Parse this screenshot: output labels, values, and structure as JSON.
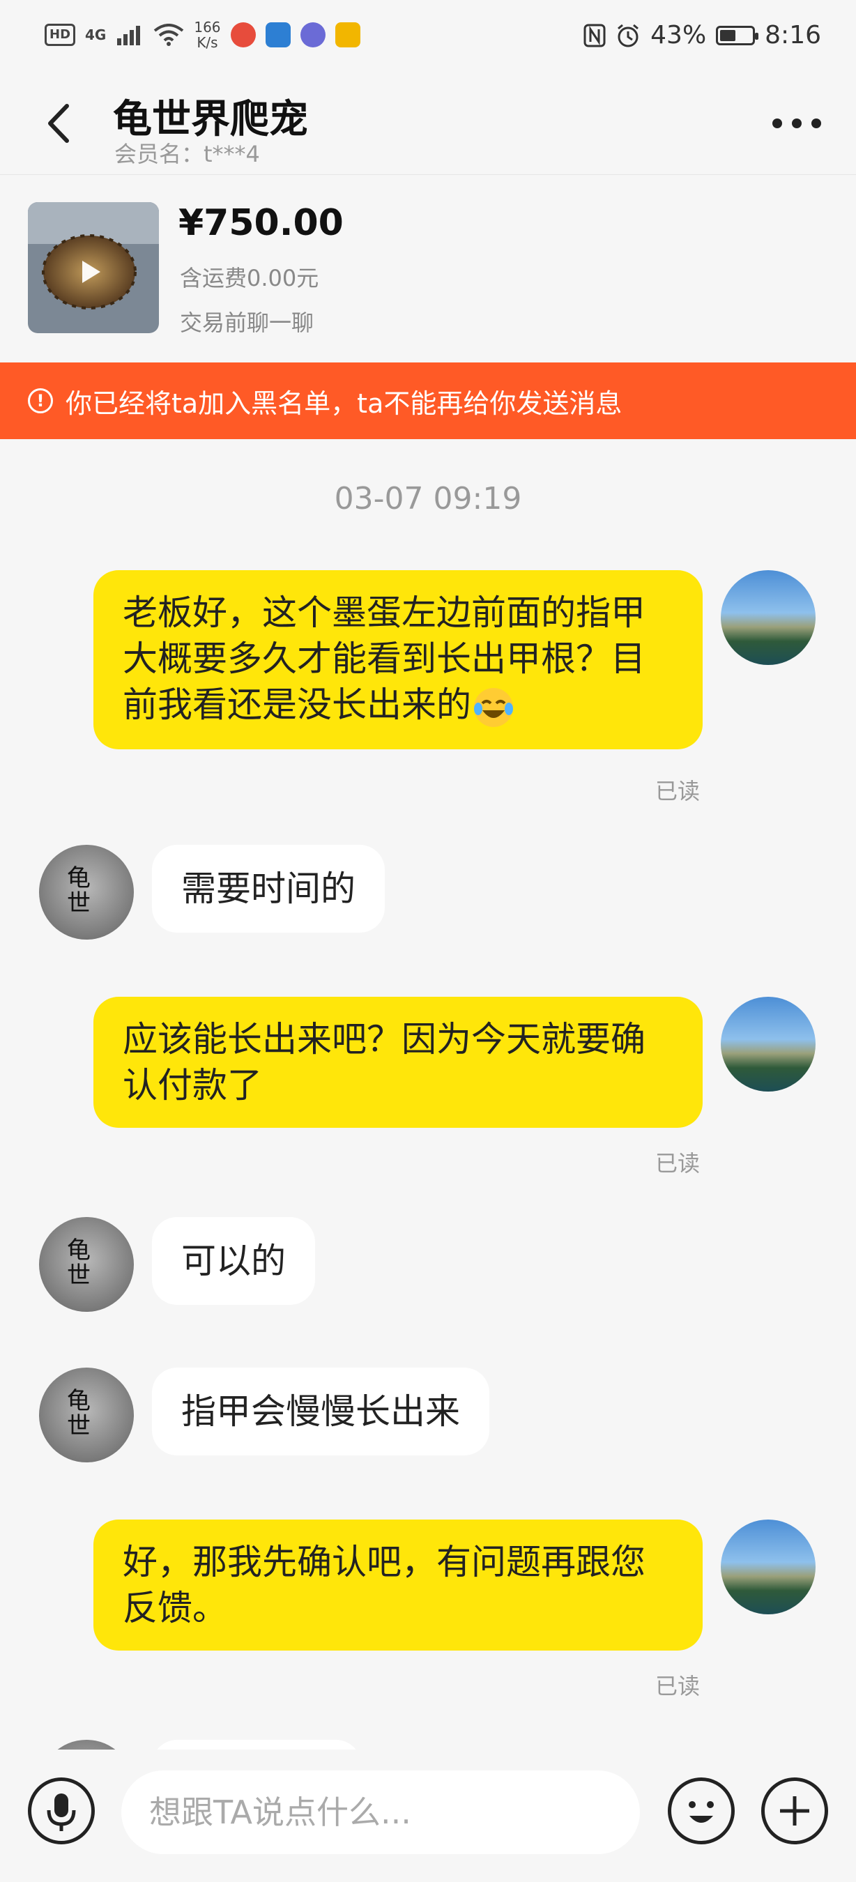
{
  "status_bar": {
    "hd": "HD",
    "network": "4G",
    "speed_value": "166",
    "speed_unit": "K/s",
    "battery_level": "43%",
    "battery_fraction": 0.43,
    "time": "8:16"
  },
  "header": {
    "title": "龟世界爬宠",
    "member_label": "会员名：t***4"
  },
  "product": {
    "price": "¥750.00",
    "shipping": "含运费0.00元",
    "pre_chat": "交易前聊一聊"
  },
  "banner": {
    "text": "你已经将ta加入黑名单，ta不能再给你发送消息"
  },
  "chat": {
    "timestamp": "03-07 09:19",
    "read_label": "已读",
    "messages": [
      {
        "side": "right",
        "text": "老板好，这个墨蛋左边前面的指甲大概要多久才能看到长出甲根？目前我看还是没长出来的"
      },
      {
        "side": "left",
        "text": "需要时间的"
      },
      {
        "side": "right",
        "text": "应该能长出来吧？因为今天就要确认付款了"
      },
      {
        "side": "left",
        "text": "可以的"
      },
      {
        "side": "left",
        "text": "指甲会慢慢长出来"
      },
      {
        "side": "right",
        "text": "好，那我先确认吧，有问题再跟您反馈。"
      }
    ]
  },
  "input_bar": {
    "placeholder": "想跟TA说点什么..."
  },
  "icons": {
    "back": "chevron-left-icon",
    "more": "more-horizontal-icon",
    "mic": "mic-icon",
    "emoji": "emoji-icon",
    "plus": "plus-icon"
  },
  "colors": {
    "accent_yellow": "#ffe60a",
    "banner_red": "#ff5a26",
    "background": "#f6f6f6"
  }
}
